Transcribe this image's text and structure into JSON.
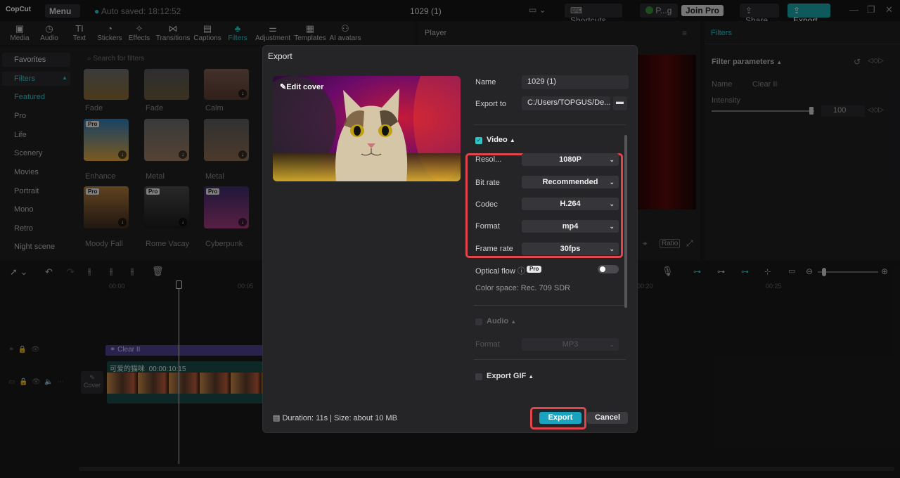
{
  "titlebar": {
    "logo": "CopCut",
    "menu": "Menu",
    "auto_saved": "Auto saved: 18:12:52",
    "project": "1029 (1)",
    "shortcuts": "Shortcuts",
    "profile": "P...g",
    "join_pro": "Join Pro",
    "share": "Share",
    "export": "Export"
  },
  "toolbar": {
    "items": [
      "Media",
      "Audio",
      "Text",
      "Stickers",
      "Effects",
      "Transitions",
      "Captions",
      "Filters",
      "Adjustment",
      "Templates",
      "AI avatars"
    ],
    "active": "Filters"
  },
  "sidebar": {
    "favorites": "Favorites",
    "filters": "Filters",
    "items": [
      "Featured",
      "Pro",
      "Life",
      "Scenery",
      "Movies",
      "Portrait",
      "Mono",
      "Retro",
      "Night scene"
    ],
    "search_placeholder": "Search for filters"
  },
  "filter_grid": {
    "row1": [
      "Fade",
      "Fade",
      "Calm"
    ],
    "row2": [
      "Enhance",
      "Metal",
      "Metal"
    ],
    "row3": [
      "Moody Fall",
      "Rome Vacay",
      "Cyberpunk"
    ],
    "pro_label": "Pro"
  },
  "player": {
    "title": "Player",
    "ratio": "Ratio"
  },
  "filters_panel": {
    "title": "Filters",
    "params_title": "Filter parameters",
    "name_label": "Name",
    "name_value": "Clear II",
    "intensity_label": "Intensity",
    "intensity_value": "100"
  },
  "timeline": {
    "ruler": [
      "00:00",
      "00:05",
      "00:20",
      "00:25"
    ],
    "filter_clip": "Clear II",
    "video_clip_title": "可爱的猫咪",
    "video_clip_duration": "00:00:10:15",
    "cover": "Cover"
  },
  "dialog": {
    "title": "Export",
    "edit_cover": "Edit cover",
    "name_label": "Name",
    "name_value": "1029 (1)",
    "export_to_label": "Export to",
    "export_to_value": "C:/Users/TOPGUS/De...",
    "video_section": "Video",
    "resolution_label": "Resol...",
    "resolution_value": "1080P",
    "bitrate_label": "Bit rate",
    "bitrate_value": "Recommended",
    "codec_label": "Codec",
    "codec_value": "H.264",
    "format_label": "Format",
    "format_value": "mp4",
    "framerate_label": "Frame rate",
    "framerate_value": "30fps",
    "optical_flow_label": "Optical flow",
    "pro_badge": "Pro",
    "color_space": "Color space: Rec. 709 SDR",
    "audio_section": "Audio",
    "audio_format_label": "Format",
    "audio_format_value": "MP3",
    "gif_section": "Export GIF",
    "duration_info": "Duration: 11s | Size: about 10 MB",
    "export_button": "Export",
    "cancel_button": "Cancel"
  },
  "colors": {
    "accent": "#1aa3a8",
    "highlight": "#e0464b"
  }
}
